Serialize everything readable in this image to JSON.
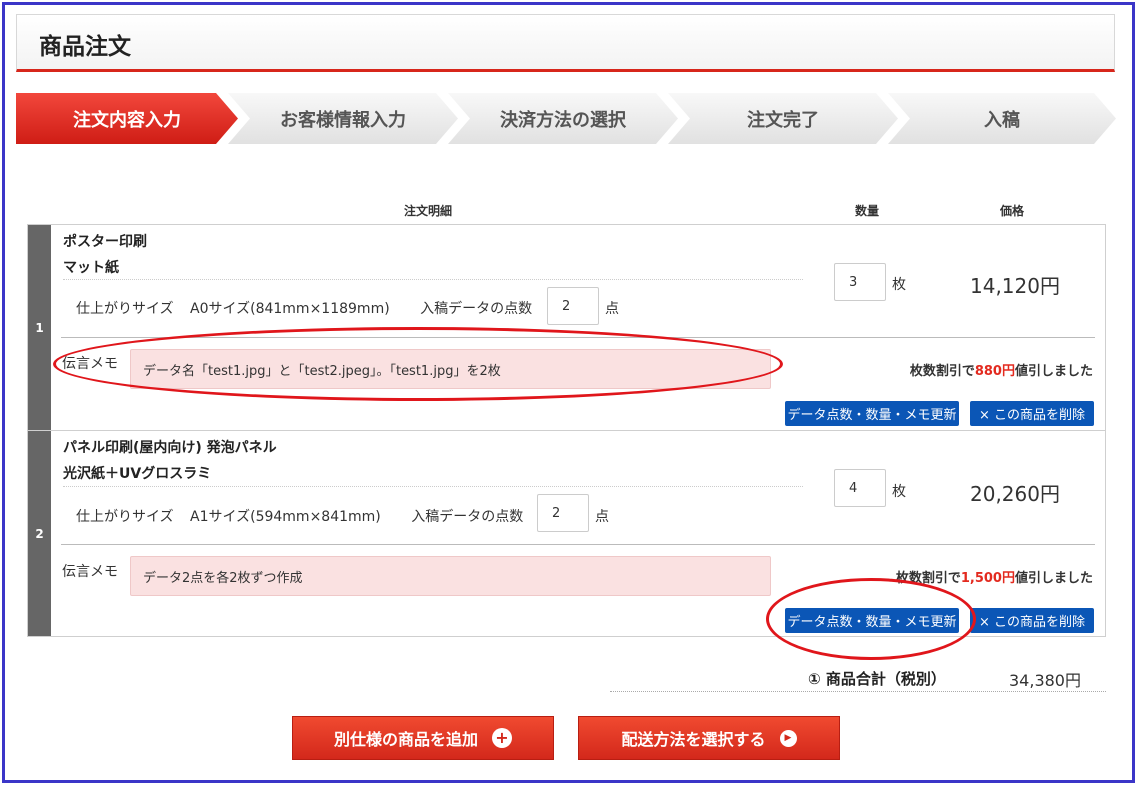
{
  "page_title": "商品注文",
  "steps": [
    "注文内容入力",
    "お客様情報入力",
    "決済方法の選択",
    "注文完了",
    "入稿"
  ],
  "columns": {
    "detail": "注文明細",
    "quantity": "数量",
    "price": "価格"
  },
  "items": [
    {
      "num": "1",
      "product": "ポスター印刷",
      "paper": "マット紙",
      "size_label": "仕上がりサイズ",
      "size_value": "A0サイズ(841mm×1189mm)",
      "data_count_label": "入稿データの点数",
      "data_count": "2",
      "data_count_unit": "点",
      "quantity": "3",
      "quantity_unit": "枚",
      "price": "14,120円",
      "memo_label": "伝言メモ",
      "memo": "データ名「test1.jpg」と「test2.jpeg」。「test1.jpg」を2枚",
      "discount_prefix": "枚数割引で",
      "discount_amount": "880円",
      "discount_suffix": "値引しました",
      "update_button": "データ点数・数量・メモ更新",
      "delete_button": "× この商品を削除"
    },
    {
      "num": "2",
      "product": "パネル印刷(屋内向け) 発泡パネル",
      "paper": "光沢紙＋UVグロスラミ",
      "size_label": "仕上がりサイズ",
      "size_value": "A1サイズ(594mm×841mm)",
      "data_count_label": "入稿データの点数",
      "data_count": "2",
      "data_count_unit": "点",
      "quantity": "4",
      "quantity_unit": "枚",
      "price": "20,260円",
      "memo_label": "伝言メモ",
      "memo": "データ2点を各2枚ずつ作成",
      "discount_prefix": "枚数割引で",
      "discount_amount": "1,500円",
      "discount_suffix": "値引しました",
      "update_button": "データ点数・数量・メモ更新",
      "delete_button": "× この商品を削除"
    }
  ],
  "subtotal": {
    "label": "① 商品合計（税別）",
    "value": "34,380円"
  },
  "actions": {
    "add_product": "別仕様の商品を追加",
    "select_shipping": "配送方法を選択する"
  },
  "colors": {
    "accent_red": "#d7261b",
    "button_blue": "#0b56b6",
    "annotation_red": "#e0161b",
    "frame_blue": "#3b35c8"
  }
}
